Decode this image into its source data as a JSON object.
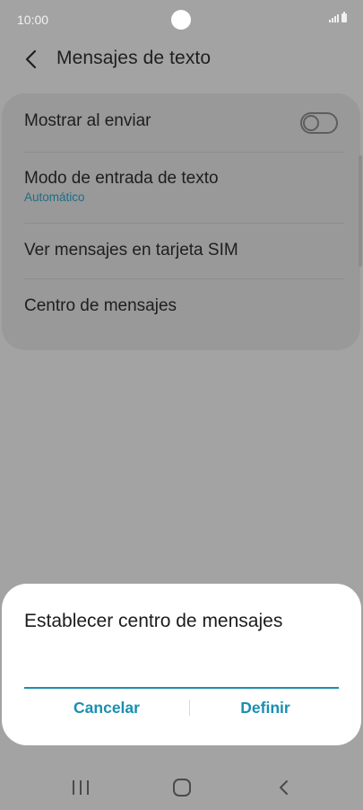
{
  "status_bar": {
    "time": "10:00",
    "icons": [
      "signal-icon",
      "battery-icon"
    ]
  },
  "header": {
    "back_icon": "chevron-left-icon",
    "title": "Mensajes de texto"
  },
  "settings": {
    "items": [
      {
        "label": "Mostrar al enviar",
        "toggle_on": false
      },
      {
        "label": "Modo de entrada de texto",
        "value": "Automático"
      },
      {
        "label": "Ver mensajes en tarjeta SIM"
      },
      {
        "label": "Centro de mensajes"
      }
    ]
  },
  "dialog": {
    "title": "Establecer centro de mensajes",
    "input_value": "",
    "cancel_label": "Cancelar",
    "define_label": "Definir"
  },
  "nav_bar": {
    "buttons": [
      "recents-icon",
      "home-icon",
      "back-icon"
    ]
  },
  "colors": {
    "accent": "#1a8fb0",
    "dimmed_background": "#a3a3a3",
    "card": "#999999",
    "dialog": "#ffffff"
  }
}
